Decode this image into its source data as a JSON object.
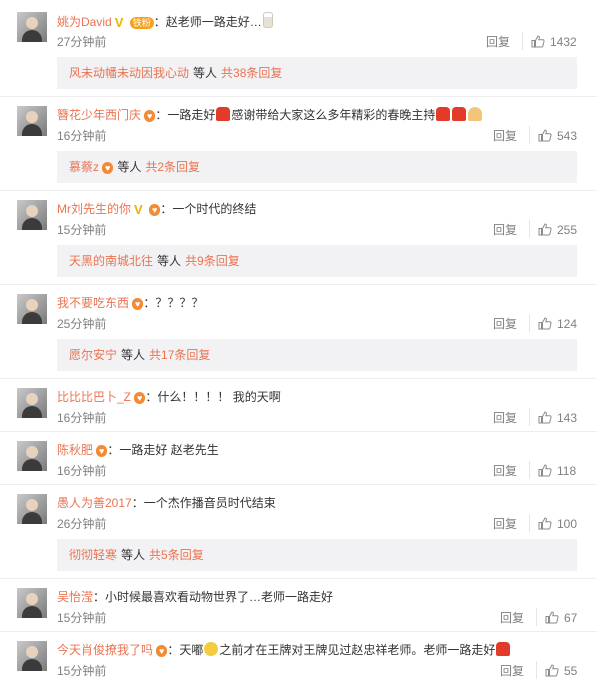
{
  "labels": {
    "reply": "回复",
    "others": "等人"
  },
  "colors": {
    "username": "#eb7350",
    "link": "#eb7350",
    "meta": "#808080",
    "subbox_bg": "#f2f2f5"
  },
  "comments": [
    {
      "user": "姚为David",
      "badges": [
        "vip",
        "fan"
      ],
      "fan_text": "铁粉",
      "text": "：赵老师一路走好…",
      "emoji_after": [
        "candle"
      ],
      "time": "27分钟前",
      "likes": "1432",
      "sub": {
        "name": "风未动幡未动因我心动",
        "more": "共38条回复"
      }
    },
    {
      "user": "簪花少年西门庆",
      "badges": [
        "heart"
      ],
      "text": "：一路走好",
      "emoji_mid": [
        "red"
      ],
      "text2": "感谢带给大家这么多年精彩的春晚主持",
      "emoji_after": [
        "red",
        "red",
        "pray"
      ],
      "time": "16分钟前",
      "likes": "543",
      "sub": {
        "name": "慕蔡z",
        "badges": [
          "heart"
        ],
        "more": "共2条回复"
      }
    },
    {
      "user": "Mr刘先生的你",
      "badges": [
        "vip",
        "heart"
      ],
      "text": "：一个时代的终结",
      "time": "15分钟前",
      "likes": "255",
      "sub": {
        "name": "天黑的南城北往",
        "more": "共9条回复"
      }
    },
    {
      "user": "我不要吃东西",
      "badges": [
        "heart"
      ],
      "text": "：？？？？",
      "time": "25分钟前",
      "likes": "124",
      "sub": {
        "name": "愿尔安宁",
        "more": "共17条回复"
      }
    },
    {
      "user": "比比比巴卜_Z",
      "badges": [
        "heart"
      ],
      "text": "：什么！！！！ 我的天啊",
      "time": "16分钟前",
      "likes": "143"
    },
    {
      "user": "陈秋肥",
      "badges": [
        "heart"
      ],
      "text": "：一路走好 赵老先生",
      "time": "16分钟前",
      "likes": "118"
    },
    {
      "user": "愚人为善2017",
      "badges": [],
      "text": "：一个杰作播音员时代结束",
      "time": "26分钟前",
      "likes": "100",
      "sub": {
        "name": "彻彻轻寒",
        "more": "共5条回复"
      }
    },
    {
      "user": "吴怡滢",
      "badges": [],
      "text": "：小时候最喜欢看动物世界了…老师一路走好",
      "time": "15分钟前",
      "likes": "67"
    },
    {
      "user": "今天肖俊撩我了吗",
      "badges": [
        "heart"
      ],
      "text": "：天嘟",
      "emoji_mid": [
        "cry"
      ],
      "text2": "之前才在王牌对王牌见过赵忠祥老师。老师一路走好",
      "emoji_after": [
        "red"
      ],
      "time": "15分钟前",
      "likes": "55"
    }
  ]
}
